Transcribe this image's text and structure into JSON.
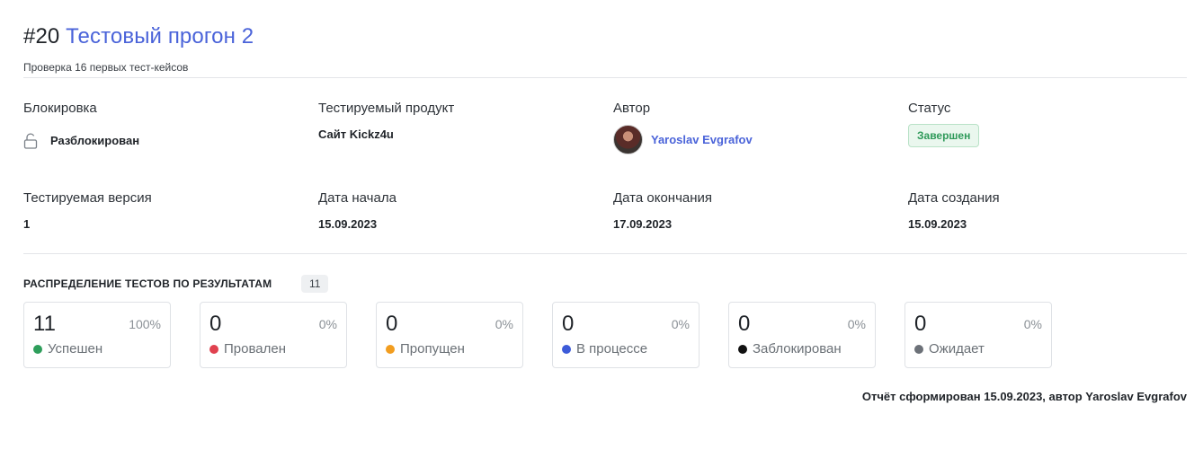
{
  "header": {
    "run_number": "#20",
    "run_title": "Тестовый прогон 2",
    "subtitle": "Проверка 16 первых тест-кейсов"
  },
  "fields": {
    "lock": {
      "label": "Блокировка",
      "value": "Разблокирован"
    },
    "product": {
      "label": "Тестируемый продукт",
      "value": "Сайт Kickz4u"
    },
    "author": {
      "label": "Автор",
      "value": "Yaroslav Evgrafov"
    },
    "status": {
      "label": "Статус",
      "value": "Завершен"
    },
    "version": {
      "label": "Тестируемая версия",
      "value": "1"
    },
    "start_date": {
      "label": "Дата начала",
      "value": "15.09.2023"
    },
    "end_date": {
      "label": "Дата окончания",
      "value": "17.09.2023"
    },
    "created_date": {
      "label": "Дата создания",
      "value": "15.09.2023"
    }
  },
  "distribution": {
    "title": "РАСПРЕДЕЛЕНИЕ ТЕСТОВ ПО РЕЗУЛЬТАТАМ",
    "total": "11",
    "cards": [
      {
        "value": "11",
        "percent": "100%",
        "label": "Успешен",
        "color": "#2e9e5b"
      },
      {
        "value": "0",
        "percent": "0%",
        "label": "Провален",
        "color": "#e0414f"
      },
      {
        "value": "0",
        "percent": "0%",
        "label": "Пропущен",
        "color": "#f29d1f"
      },
      {
        "value": "0",
        "percent": "0%",
        "label": "В процессе",
        "color": "#3d5bd9"
      },
      {
        "value": "0",
        "percent": "0%",
        "label": "Заблокирован",
        "color": "#111111"
      },
      {
        "value": "0",
        "percent": "0%",
        "label": "Ожидает",
        "color": "#6c7178"
      }
    ]
  },
  "footer": {
    "text": "Отчёт сформирован 15.09.2023, автор Yaroslav Evgrafov"
  },
  "icons": {
    "lock": "unlock-icon"
  }
}
